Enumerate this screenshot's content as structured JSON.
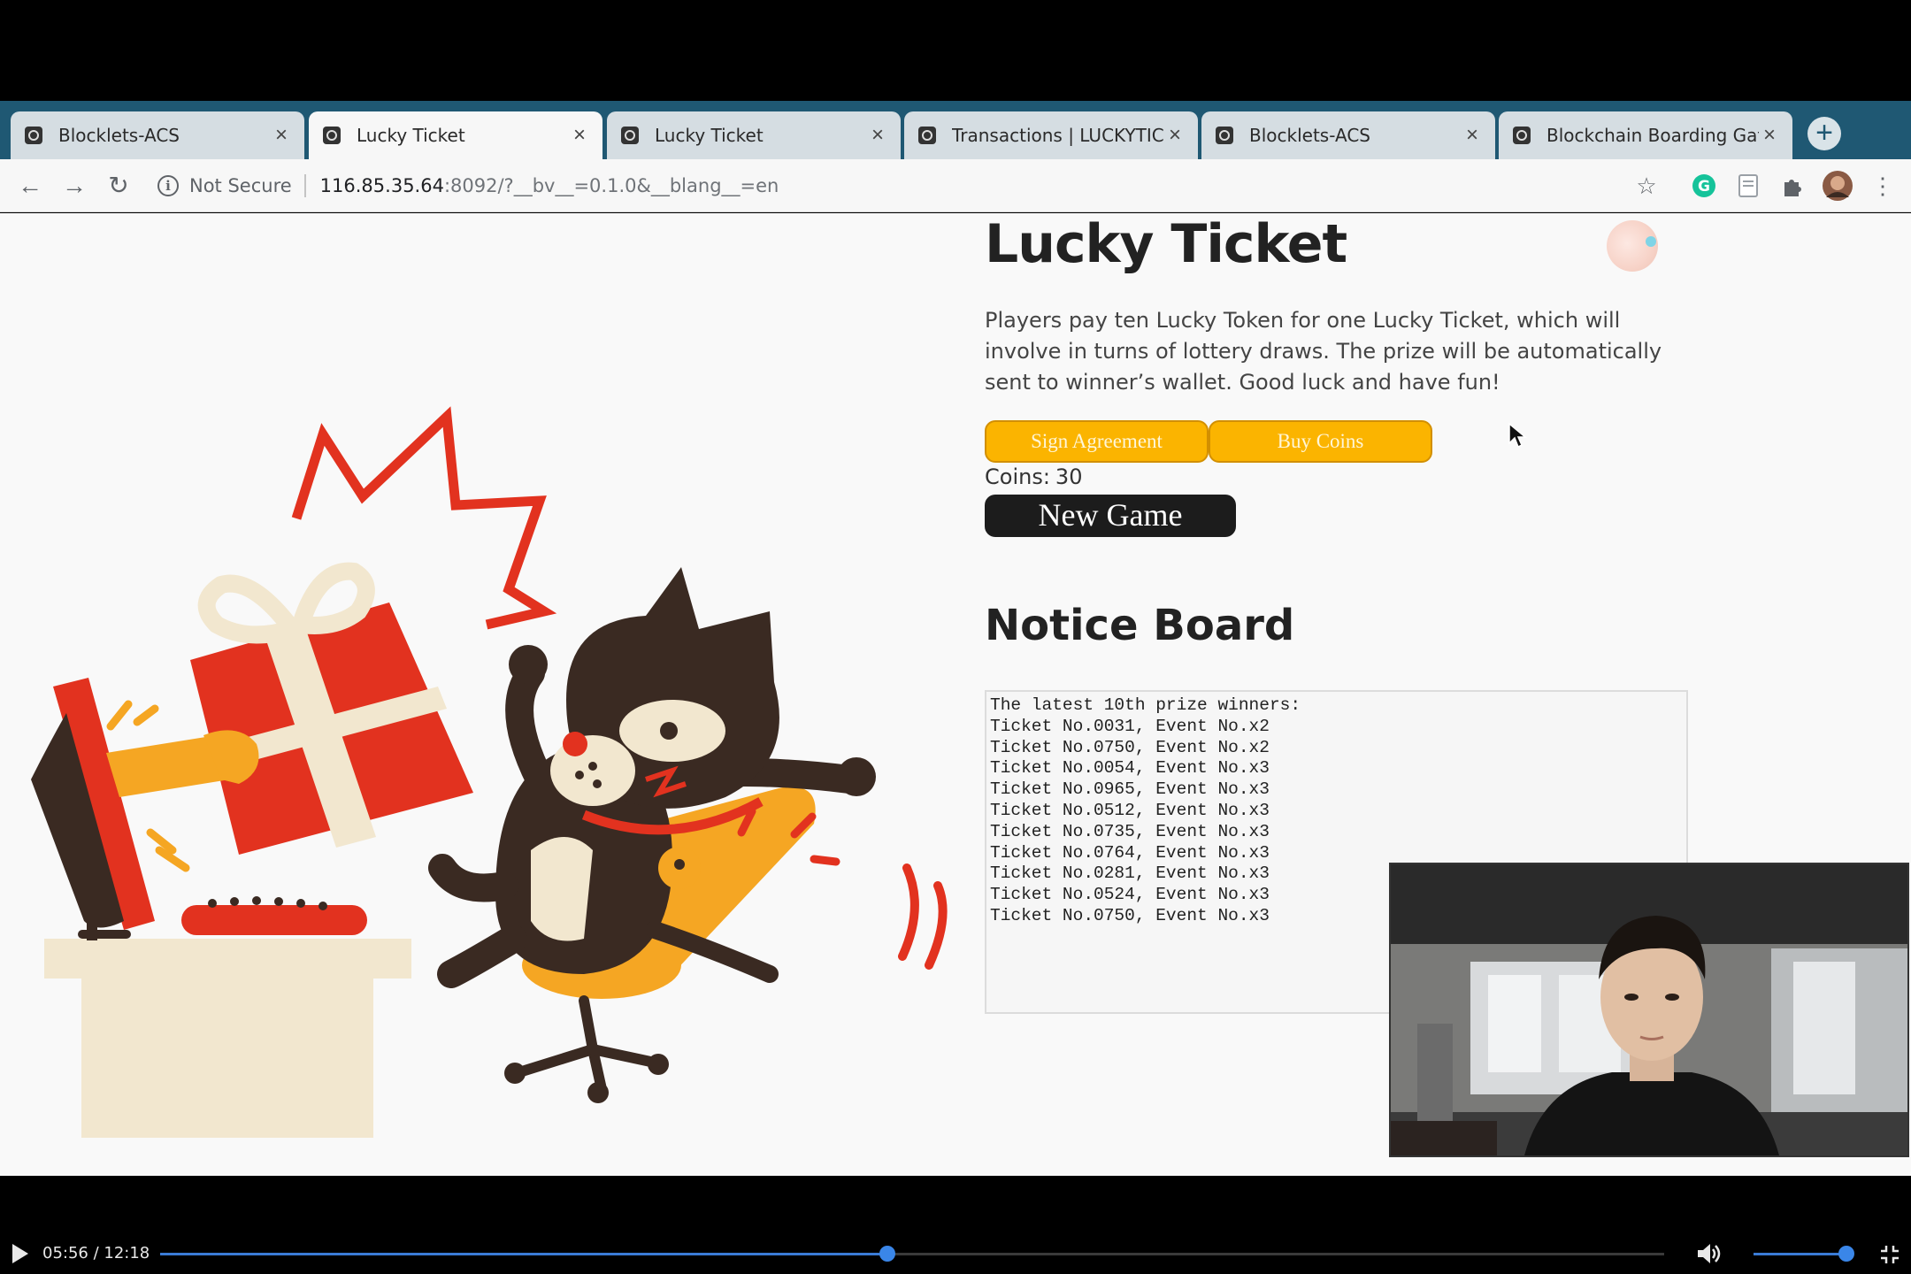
{
  "browser": {
    "tabs": [
      {
        "title": "Blocklets-ACS",
        "active": false
      },
      {
        "title": "Lucky Ticket",
        "active": true
      },
      {
        "title": "Lucky Ticket",
        "active": false
      },
      {
        "title": "Transactions | LUCKYTIC",
        "active": false
      },
      {
        "title": "Blocklets-ACS",
        "active": false
      },
      {
        "title": "Blockchain Boarding Gate",
        "active": false
      }
    ],
    "new_tab_symbol": "+",
    "close_symbol": "×",
    "security_label": "Not Secure",
    "url_host": "116.85.35.64",
    "url_rest": ":8092/?__bv__=0.1.0&__blang__=en",
    "icons": [
      "back-icon",
      "forward-icon",
      "reload-icon",
      "info-icon",
      "star-icon",
      "grammarly-icon",
      "reader-icon",
      "extensions-icon",
      "profile-avatar",
      "menu-icon"
    ]
  },
  "app": {
    "title": "Lucky Ticket",
    "description": "Players pay ten Lucky Token for one Lucky Ticket, which will involve in turns of lottery draws. The prize will be automatically sent to winner’s wallet. Good luck and have fun!",
    "buttons": {
      "sign_agreement": "Sign Agreement",
      "buy_coins": "Buy Coins",
      "new_game": "New Game"
    },
    "coins_label": "Coins:",
    "coins_value": "30",
    "colors": {
      "accent_yellow": "#fbb400",
      "dark_button": "#1c1c1c"
    }
  },
  "notice_board": {
    "title": "Notice Board",
    "lines": [
      "The latest 10th prize winners:",
      "Ticket No.0031, Event No.x2",
      "Ticket No.0750, Event No.x2",
      "Ticket No.0054, Event No.x3",
      "Ticket No.0965, Event No.x3",
      "Ticket No.0512, Event No.x3",
      "Ticket No.0735, Event No.x3",
      "Ticket No.0764, Event No.x3",
      "Ticket No.0281, Event No.x3",
      "Ticket No.0524, Event No.x3",
      "Ticket No.0750, Event No.x3"
    ]
  },
  "video_player": {
    "time_current": "05:56",
    "time_total": "12:18",
    "progress": 0.4835,
    "volume": 0.89
  }
}
